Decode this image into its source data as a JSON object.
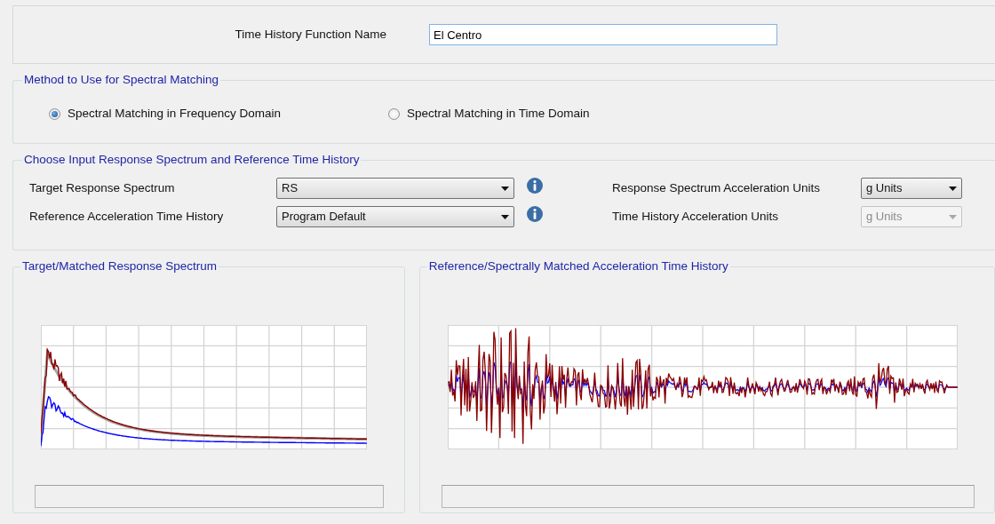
{
  "name_field": {
    "label": "Time History Function Name",
    "value": "El Centro"
  },
  "method": {
    "title": "Method to Use for Spectral Matching",
    "options": [
      {
        "label": "Spectral Matching in Frequency Domain",
        "selected": true
      },
      {
        "label": "Spectral Matching in Time Domain",
        "selected": false
      }
    ]
  },
  "input": {
    "title": "Choose Input Response Spectrum and Reference Time History",
    "left_fields": [
      {
        "label": "Target Response Spectrum",
        "value": "RS",
        "disabled": false
      },
      {
        "label": "Reference Acceleration Time History",
        "value": "Program Default",
        "disabled": false
      }
    ],
    "right_fields": [
      {
        "label": "Response Spectrum Acceleration Units",
        "value": "g Units",
        "disabled": false
      },
      {
        "label": "Time History Acceleration Units",
        "value": "g Units",
        "disabled": true
      }
    ]
  },
  "panels": [
    {
      "title": "Target/Matched Response Spectrum",
      "kind": "spectrum"
    },
    {
      "title": "Reference/Spectrally Matched Acceleration Time History",
      "kind": "time_history"
    }
  ]
}
